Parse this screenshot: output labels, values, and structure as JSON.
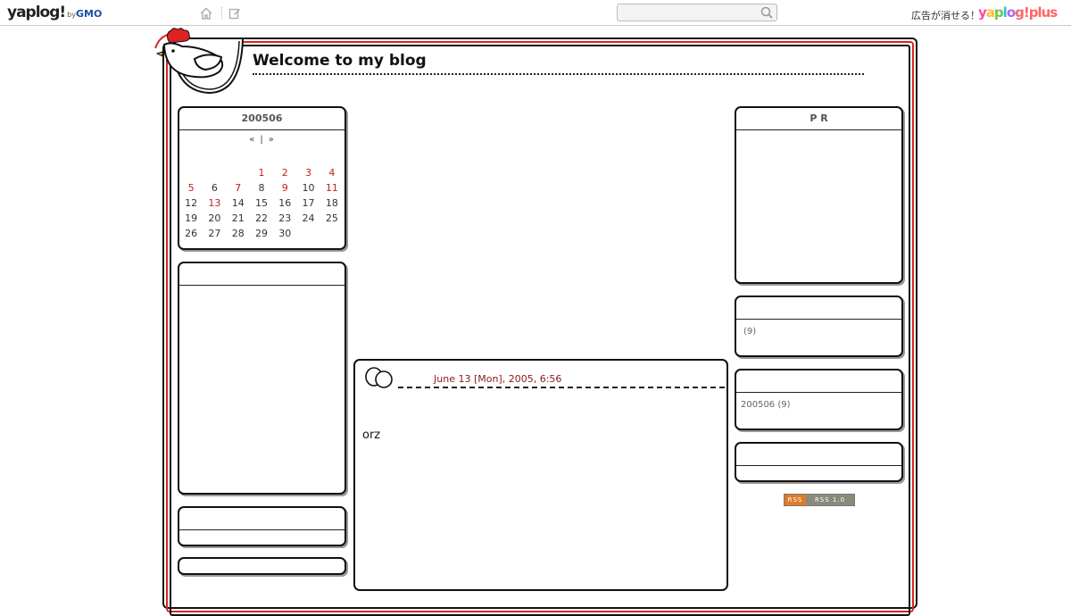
{
  "topbar": {
    "logo": "yaplog!",
    "logo_by": "by",
    "logo_gmo": "GMO",
    "search_placeholder": "",
    "ad_text": "広告が消せる！",
    "plus_logo": [
      "y",
      "a",
      "p",
      "l",
      "o",
      "g!plus"
    ]
  },
  "blog": {
    "title": "Welcome to my blog"
  },
  "calendar": {
    "header": "200506",
    "prev": "«",
    "sep": "|",
    "next": "»",
    "weeks": [
      [
        {
          "d": ""
        },
        {
          "d": ""
        },
        {
          "d": ""
        },
        {
          "d": "1",
          "red": true
        },
        {
          "d": "2",
          "red": true
        },
        {
          "d": "3",
          "red": true
        },
        {
          "d": "4",
          "red": true
        }
      ],
      [
        {
          "d": "5",
          "red": true
        },
        {
          "d": "6"
        },
        {
          "d": "7",
          "red": true
        },
        {
          "d": "8"
        },
        {
          "d": "9",
          "red": true
        },
        {
          "d": "10"
        },
        {
          "d": "11",
          "red": true
        }
      ],
      [
        {
          "d": "12"
        },
        {
          "d": "13",
          "red": true
        },
        {
          "d": "14"
        },
        {
          "d": "15"
        },
        {
          "d": "16"
        },
        {
          "d": "17"
        },
        {
          "d": "18"
        }
      ],
      [
        {
          "d": "19"
        },
        {
          "d": "20"
        },
        {
          "d": "21"
        },
        {
          "d": "22"
        },
        {
          "d": "23"
        },
        {
          "d": "24"
        },
        {
          "d": "25"
        }
      ],
      [
        {
          "d": "26"
        },
        {
          "d": "27"
        },
        {
          "d": "28"
        },
        {
          "d": "29"
        },
        {
          "d": "30"
        },
        {
          "d": ""
        },
        {
          "d": ""
        }
      ]
    ]
  },
  "right": {
    "pr_header": "P R",
    "category_count": "(9)",
    "archive": "200506 (9)"
  },
  "entry": {
    "date": "June 13 [Mon], 2005, 6:56",
    "body": "orz"
  },
  "rss": {
    "left": "RSS",
    "right": "RSS 1.0"
  },
  "colors": {
    "accent_red": "#d22222",
    "date_red": "#8b1a1a"
  }
}
